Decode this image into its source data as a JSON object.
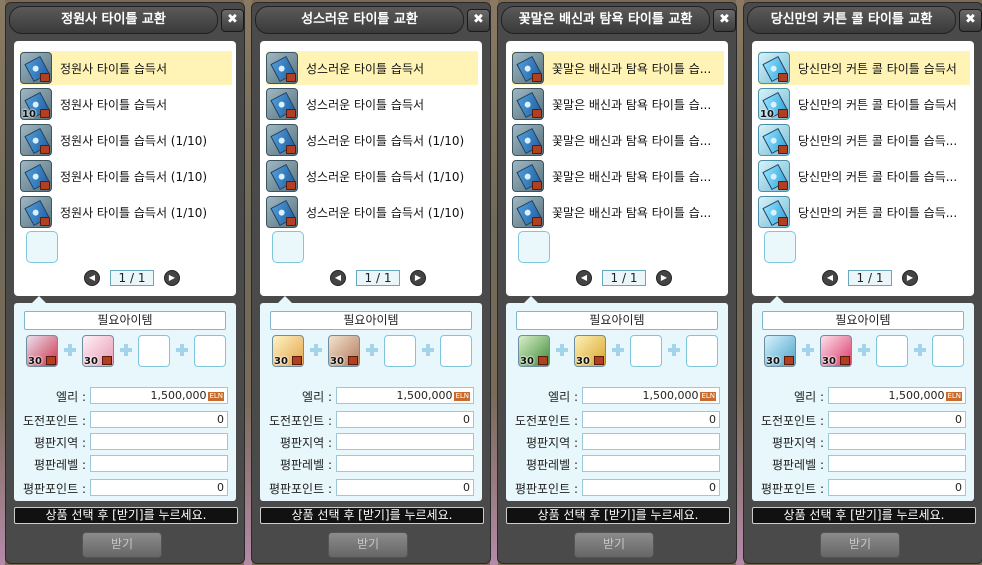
{
  "panels": [
    {
      "title": "정원사 타이틀 교환",
      "close_label": "✖",
      "icon_variant": "dark",
      "items": [
        {
          "name": "정원사 타이틀 습득서",
          "qty": "",
          "selected": true
        },
        {
          "name": "정원사 타이틀 습득서",
          "qty": "10",
          "selected": false
        },
        {
          "name": "정원사 타이틀 습득서 (1/10)",
          "qty": "",
          "selected": false
        },
        {
          "name": "정원사 타이틀 습득서 (1/10)",
          "qty": "",
          "selected": false
        },
        {
          "name": "정원사 타이틀 습득서 (1/10)",
          "qty": "",
          "selected": false
        }
      ],
      "page": "1 / 1",
      "required_header": "필요아이템",
      "required_items": [
        {
          "qty": "30",
          "colors": [
            "#e8e0f0",
            "#d0334a"
          ]
        },
        {
          "qty": "30",
          "colors": [
            "#fff0f4",
            "#e79ab6"
          ]
        },
        {
          "qty": "",
          "colors": []
        },
        {
          "qty": "",
          "colors": []
        }
      ],
      "fields": [
        {
          "label": "엘리 :",
          "value": "1,500,000",
          "meso": "ELN"
        },
        {
          "label": "도전포인트 :",
          "value": "0",
          "meso": ""
        },
        {
          "label": "평판지역 :",
          "value": "",
          "meso": ""
        },
        {
          "label": "평판레벨 :",
          "value": "",
          "meso": ""
        },
        {
          "label": "평판포인트 :",
          "value": "0",
          "meso": ""
        }
      ],
      "notice": "상품 선택 후 [받기]를 누르세요.",
      "receive_label": "받기"
    },
    {
      "title": "성스러운 타이틀 교환",
      "close_label": "✖",
      "icon_variant": "dark",
      "items": [
        {
          "name": "성스러운 타이틀 습득서",
          "qty": "",
          "selected": true
        },
        {
          "name": "성스러운 타이틀 습득서",
          "qty": "",
          "selected": false
        },
        {
          "name": "성스러운 타이틀 습득서 (1/10)",
          "qty": "",
          "selected": false
        },
        {
          "name": "성스러운 타이틀 습득서 (1/10)",
          "qty": "",
          "selected": false
        },
        {
          "name": "성스러운 타이틀 습득서 (1/10)",
          "qty": "",
          "selected": false
        }
      ],
      "page": "1 / 1",
      "required_header": "필요아이템",
      "required_items": [
        {
          "qty": "30",
          "colors": [
            "#fff3c4",
            "#e2a34a"
          ]
        },
        {
          "qty": "30",
          "colors": [
            "#f4e2cf",
            "#b07a5a"
          ]
        },
        {
          "qty": "",
          "colors": []
        },
        {
          "qty": "",
          "colors": []
        }
      ],
      "fields": [
        {
          "label": "엘리 :",
          "value": "1,500,000",
          "meso": "ELN"
        },
        {
          "label": "도전포인트 :",
          "value": "0",
          "meso": ""
        },
        {
          "label": "평판지역 :",
          "value": "",
          "meso": ""
        },
        {
          "label": "평판레벨 :",
          "value": "",
          "meso": ""
        },
        {
          "label": "평판포인트 :",
          "value": "0",
          "meso": ""
        }
      ],
      "notice": "상품 선택 후 [받기]를 누르세요.",
      "receive_label": "받기"
    },
    {
      "title": "꽃말은 배신과 탐욕 타이틀 교환",
      "close_label": "✖",
      "icon_variant": "dark",
      "items": [
        {
          "name": "꽃말은 배신과 탐욕 타이틀 습...",
          "qty": "",
          "selected": true
        },
        {
          "name": "꽃말은 배신과 탐욕 타이틀 습...",
          "qty": "",
          "selected": false
        },
        {
          "name": "꽃말은 배신과 탐욕 타이틀 습...",
          "qty": "",
          "selected": false
        },
        {
          "name": "꽃말은 배신과 탐욕 타이틀 습...",
          "qty": "",
          "selected": false
        },
        {
          "name": "꽃말은 배신과 탐욕 타이틀 습...",
          "qty": "",
          "selected": false
        }
      ],
      "page": "1 / 1",
      "required_header": "필요아이템",
      "required_items": [
        {
          "qty": "30",
          "colors": [
            "#d9f0c8",
            "#3f8a3a"
          ]
        },
        {
          "qty": "30",
          "colors": [
            "#fff0b8",
            "#d7a52a"
          ]
        },
        {
          "qty": "",
          "colors": []
        },
        {
          "qty": "",
          "colors": []
        }
      ],
      "fields": [
        {
          "label": "엘리 :",
          "value": "1,500,000",
          "meso": "ELN"
        },
        {
          "label": "도전포인트 :",
          "value": "0",
          "meso": ""
        },
        {
          "label": "평판지역 :",
          "value": "",
          "meso": ""
        },
        {
          "label": "평판레벨 :",
          "value": "",
          "meso": ""
        },
        {
          "label": "평판포인트 :",
          "value": "0",
          "meso": ""
        }
      ],
      "notice": "상품 선택 후 [받기]를 누르세요.",
      "receive_label": "받기"
    },
    {
      "title": "당신만의 커튼 콜 타이틀 교환",
      "close_label": "✖",
      "icon_variant": "light",
      "items": [
        {
          "name": "당신만의 커튼 콜 타이틀 습득서",
          "qty": "",
          "selected": true
        },
        {
          "name": "당신만의 커튼 콜 타이틀 습득서",
          "qty": "10",
          "selected": false
        },
        {
          "name": "당신만의 커튼 콜 타이틀 습득...",
          "qty": "",
          "selected": false
        },
        {
          "name": "당신만의 커튼 콜 타이틀 습득...",
          "qty": "",
          "selected": false
        },
        {
          "name": "당신만의 커튼 콜 타이틀 습득...",
          "qty": "",
          "selected": false
        }
      ],
      "page": "1 / 1",
      "required_header": "필요아이템",
      "required_items": [
        {
          "qty": "30",
          "colors": [
            "#d8f2ff",
            "#4aa3c8"
          ]
        },
        {
          "qty": "30",
          "colors": [
            "#ffe0ea",
            "#d8386a"
          ]
        },
        {
          "qty": "",
          "colors": []
        },
        {
          "qty": "",
          "colors": []
        }
      ],
      "fields": [
        {
          "label": "엘리 :",
          "value": "1,500,000",
          "meso": "ELN"
        },
        {
          "label": "도전포인트 :",
          "value": "0",
          "meso": ""
        },
        {
          "label": "평판지역 :",
          "value": "",
          "meso": ""
        },
        {
          "label": "평판레벨 :",
          "value": "",
          "meso": ""
        },
        {
          "label": "평판포인트 :",
          "value": "0",
          "meso": ""
        }
      ],
      "notice": "상품 선택 후 [받기]를 누르세요.",
      "receive_label": "받기"
    }
  ]
}
